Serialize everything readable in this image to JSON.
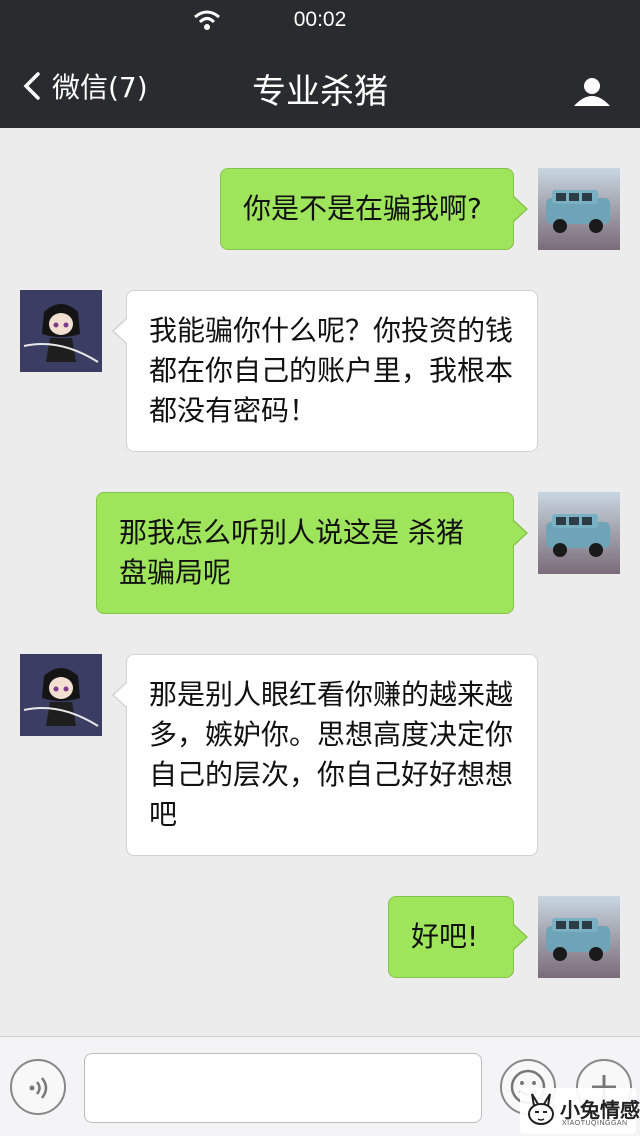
{
  "status_bar": {
    "time": "00:02",
    "wifi_icon": "wifi-icon"
  },
  "nav": {
    "back_label": "微信(7)",
    "title": "专业杀猪",
    "back_icon": "chevron-left-icon",
    "profile_icon": "person-icon"
  },
  "messages": [
    {
      "direction": "outgoing",
      "text": "你是不是在骗我啊?",
      "avatar": "car-avatar"
    },
    {
      "direction": "incoming",
      "text": "我能骗你什么呢？你投资的钱都在你自己的账户里，我根本都没有密码！",
      "avatar": "anime-girl-avatar"
    },
    {
      "direction": "outgoing",
      "text": "那我怎么听别人说这是 杀猪盘骗局呢",
      "avatar": "car-avatar"
    },
    {
      "direction": "incoming",
      "text": "那是别人眼红看你赚的越来越多，嫉妒你。思想高度决定你自己的层次，你自己好好想想吧",
      "avatar": "anime-girl-avatar"
    },
    {
      "direction": "outgoing",
      "text": "好吧!",
      "avatar": "car-avatar"
    }
  ],
  "input_bar": {
    "input_value": "",
    "voice_icon": "voice-icon",
    "emoji_icon": "emoji-icon",
    "plus_icon": "plus-icon"
  },
  "watermark": {
    "text": "小兔情感",
    "subtext": "XIAOTUQINGGAN"
  },
  "colors": {
    "nav_bg": "#2a2b2f",
    "outgoing_bubble": "#9fe55b",
    "incoming_bubble": "#ffffff",
    "chat_bg": "#ececec"
  }
}
